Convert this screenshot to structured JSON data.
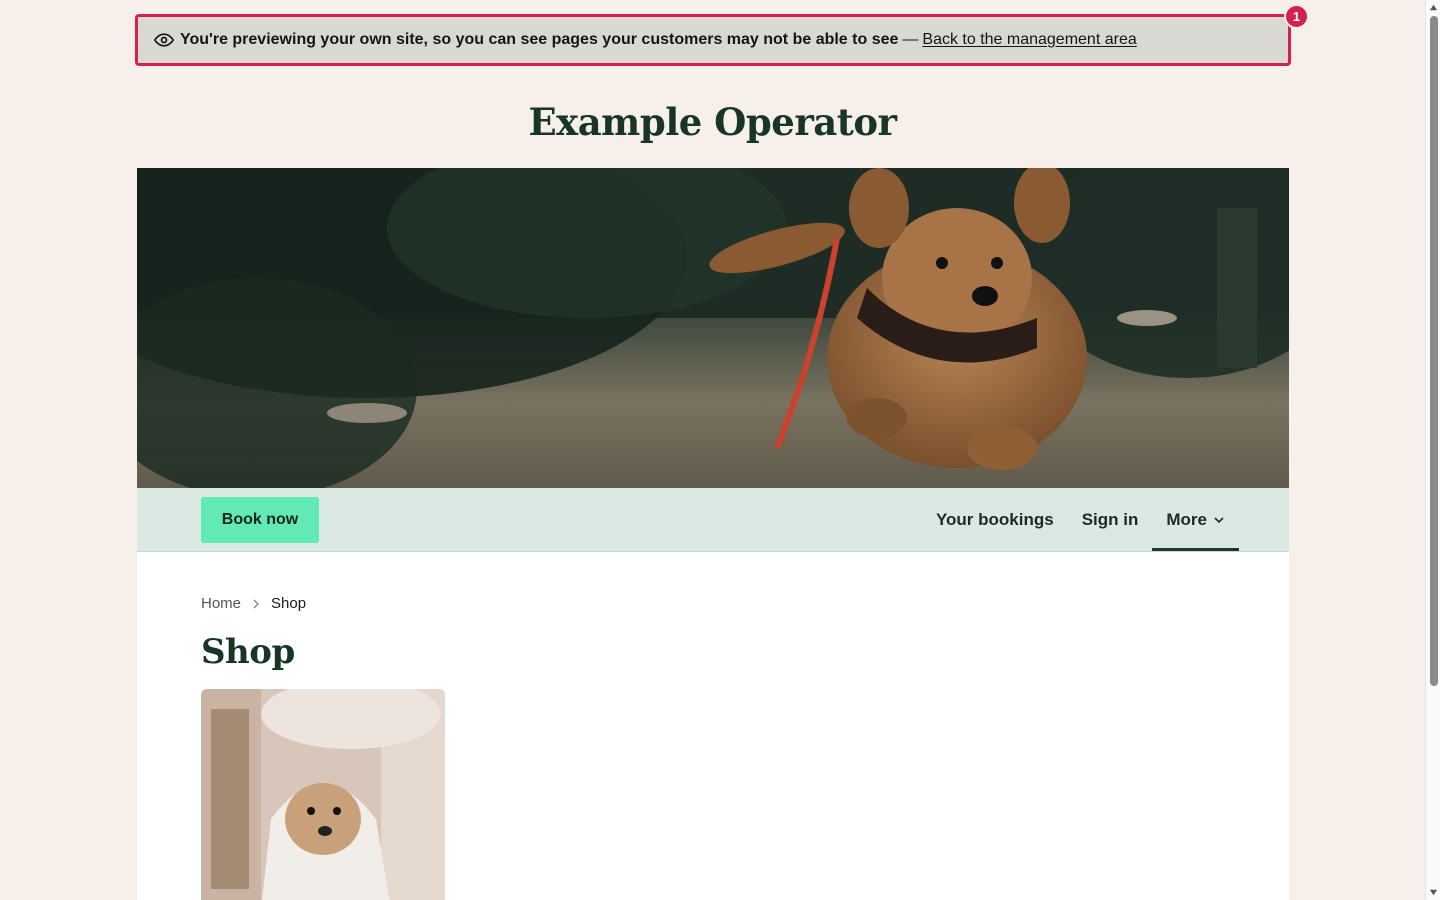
{
  "preview_banner": {
    "message": "You're previewing your own site, so you can see pages your customers may not be able to see",
    "separator": "—",
    "link_label": "Back to the management area",
    "badge_count": "1",
    "icon": "eye-icon"
  },
  "site": {
    "title": "Example Operator"
  },
  "hero": {
    "image": "running-puppy-photo"
  },
  "nav": {
    "book_label": "Book now",
    "links": [
      {
        "label": "Your bookings"
      },
      {
        "label": "Sign in"
      },
      {
        "label": "More"
      }
    ],
    "active": "More"
  },
  "breadcrumb": {
    "items": [
      "Home",
      "Shop"
    ]
  },
  "page": {
    "title": "Shop"
  },
  "products": [
    {
      "image": "dog-in-towel-photo"
    }
  ],
  "colors": {
    "page_bg": "#f6efea",
    "banner_border": "#d6214f",
    "brand_dark": "#173626",
    "nav_bg": "#dbe9e3",
    "book_button": "#63eab4"
  }
}
